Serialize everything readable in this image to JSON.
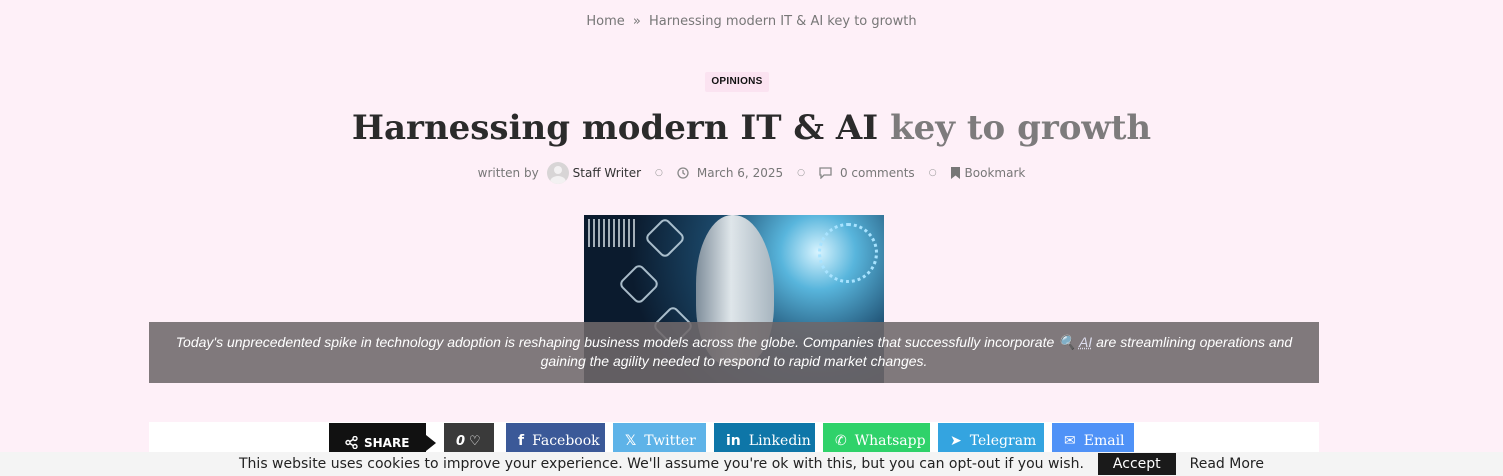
{
  "breadcrumb": {
    "home": "Home",
    "separator": "»",
    "current": "Harnessing modern IT & AI key to growth"
  },
  "category": "OPINIONS",
  "title": {
    "part1": "Harnessing modern IT & AI",
    "part2": "key to growth"
  },
  "meta": {
    "written_by": "written by",
    "author": "Staff Writer",
    "date": "March 6, 2025",
    "comments": "0 comments",
    "bookmark": "Bookmark"
  },
  "caption": {
    "before": "Today's unprecedented spike in technology adoption is reshaping business models across the globe. Companies that successfully incorporate",
    "link": "AI",
    "after": "are streamlining operations and gaining the agility needed to respond to rapid market changes."
  },
  "share": {
    "label": "SHARE",
    "likes": "0",
    "facebook": "Facebook",
    "twitter": "Twitter",
    "linkedin": "Linkedin",
    "whatsapp": "Whatsapp",
    "telegram": "Telegram",
    "email": "Email"
  },
  "cookie": {
    "message": "This website uses cookies to improve your experience. We'll assume you're ok with this, but you can opt-out if you wish.",
    "accept": "Accept",
    "read_more": "Read More"
  },
  "icons": [
    "clock-icon",
    "comment-icon",
    "bookmark-icon",
    "share-icon",
    "heart-icon",
    "facebook-icon",
    "x-icon",
    "linkedin-icon",
    "whatsapp-icon",
    "telegram-icon",
    "email-icon",
    "search-icon"
  ]
}
